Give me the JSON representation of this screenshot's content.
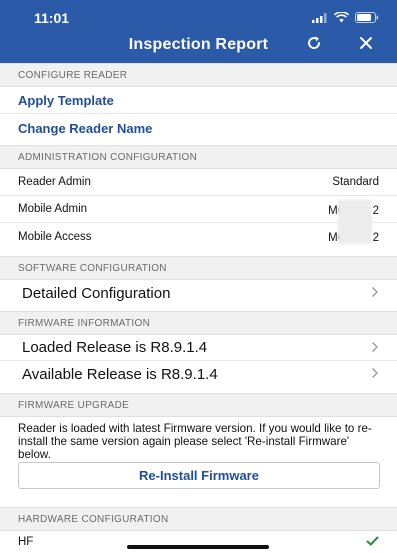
{
  "status_bar": {
    "time": "11:01"
  },
  "header": {
    "title": "Inspection Report"
  },
  "configure_reader": {
    "header": "CONFIGURE READER",
    "apply_template": "Apply Template",
    "change_reader_name": "Change Reader Name"
  },
  "administration": {
    "header": "ADMINISTRATION CONFIGURATION",
    "rows": [
      {
        "label": "Reader Admin",
        "value": "Standard"
      },
      {
        "label": "Mobile Admin",
        "value": "MO"
      },
      {
        "label": "Mobile Access",
        "value": "MO"
      }
    ],
    "obscured_suffix": [
      "2",
      "2"
    ]
  },
  "software": {
    "header": "SOFTWARE CONFIGURATION",
    "detailed_configuration": "Detailed Configuration"
  },
  "firmware_info": {
    "header": "FIRMWARE INFORMATION",
    "loaded_release": "Loaded Release is R8.9.1.4",
    "available_release": "Available Release is R8.9.1.4"
  },
  "firmware_upgrade": {
    "header": "FIRMWARE UPGRADE",
    "message": "Reader is loaded with latest Firmware version. If you would like to re-install the same version again please select 'Re-install Firmware' below.",
    "reinstall_button": "Re-Install Firmware"
  },
  "hardware": {
    "header": "HARDWARE CONFIGURATION",
    "hf_label": "HF",
    "hf_status": "ok"
  },
  "colors": {
    "brand": "#2a5aa8",
    "link": "#1f4e9a",
    "check": "#2e8b3a"
  },
  "icons": {
    "chevron": "chevron-right-icon",
    "refresh": "refresh-icon",
    "close": "close-icon",
    "check": "checkmark-icon"
  }
}
